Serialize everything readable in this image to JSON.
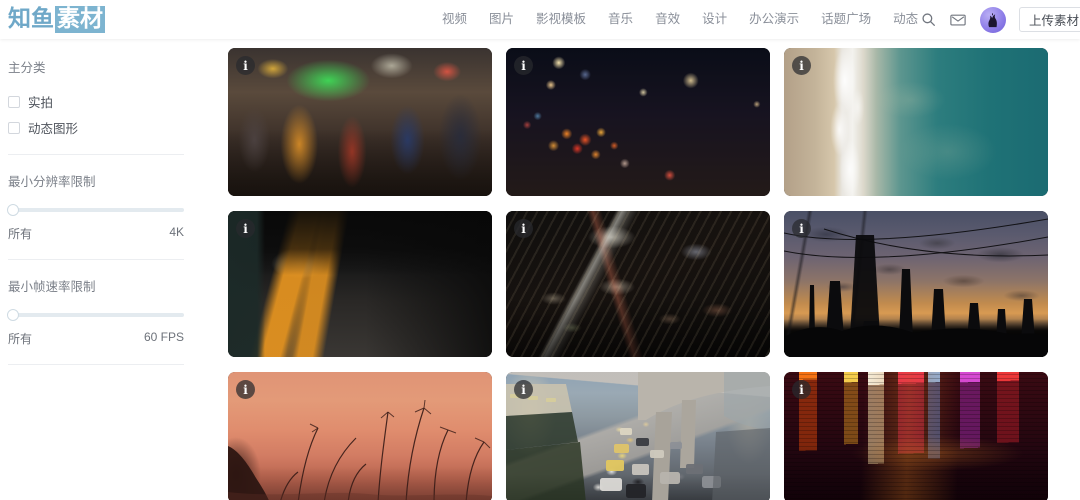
{
  "header": {
    "logo": {
      "part1": "知鱼",
      "part2": "素材",
      "accent": "#7db4d0"
    },
    "nav": [
      {
        "label": "视频"
      },
      {
        "label": "图片"
      },
      {
        "label": "影视模板"
      },
      {
        "label": "音乐"
      },
      {
        "label": "音效"
      },
      {
        "label": "设计"
      },
      {
        "label": "办公演示"
      },
      {
        "label": "话题广场"
      },
      {
        "label": "动态"
      }
    ],
    "search_icon": "search-icon",
    "message_icon": "envelope-icon",
    "avatar_label": "user-avatar",
    "upload_button": "上传素材"
  },
  "sidebar": {
    "category_title": "主分类",
    "checkboxes": [
      {
        "label": "实拍",
        "checked": false
      },
      {
        "label": "动态图形",
        "checked": false
      }
    ],
    "filters": [
      {
        "title": "最小分辨率限制",
        "min_label": "所有",
        "max_label": "4K",
        "value_percent": 0
      },
      {
        "title": "最小帧速率限制",
        "min_label": "所有",
        "max_label": "60 FPS",
        "value_percent": 0
      }
    ]
  },
  "grid": {
    "info_glyph": "i",
    "cards": [
      {
        "name": "card-street-market",
        "scene": "s-market",
        "row": "r1",
        "alt": "夜市街头小吃摊"
      },
      {
        "name": "card-night-bokeh-traffic",
        "scene": "s-bokeh",
        "row": "r1",
        "alt": "夜晚车流虚焦光斑"
      },
      {
        "name": "card-aerial-beach",
        "scene": "s-beach",
        "row": "r1",
        "alt": "航拍海滩海浪"
      },
      {
        "name": "card-subway-platform",
        "scene": "s-subway",
        "row": "r2",
        "alt": "地铁站台黄线列车"
      },
      {
        "name": "card-aerial-night-city",
        "scene": "s-city",
        "row": "r2",
        "alt": "航拍夜晚城市街区"
      },
      {
        "name": "card-dusk-power-lines",
        "scene": "s-dusk",
        "row": "r2",
        "alt": "黄昏高压电塔剪影"
      },
      {
        "name": "card-sunset-grass",
        "scene": "s-grass",
        "row": "r3",
        "alt": "日落草叶剪影"
      },
      {
        "name": "card-city-traffic",
        "scene": "s-traffic",
        "row": "r3",
        "alt": "城市高架道路车流"
      },
      {
        "name": "card-neon-wet-reflections",
        "scene": "s-neon",
        "row": "r3",
        "alt": "霓虹灯湿地面反光"
      }
    ]
  }
}
